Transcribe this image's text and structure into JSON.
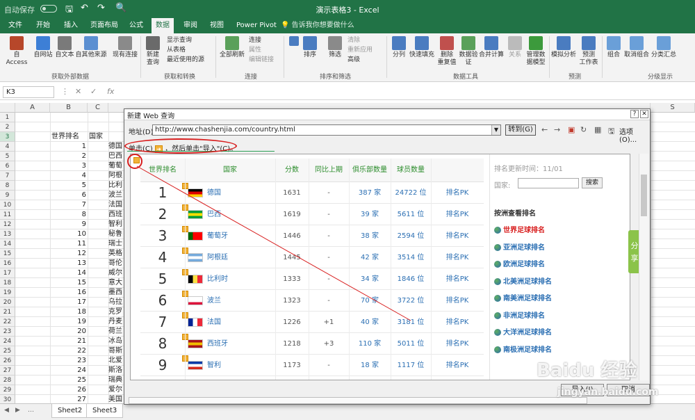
{
  "titlebar": {
    "autosave": "自动保存",
    "title": "演示表格3 - Excel"
  },
  "tabs": [
    "文件",
    "开始",
    "插入",
    "页面布局",
    "公式",
    "数据",
    "审阅",
    "视图",
    "Power Pivot"
  ],
  "tell_me": "告诉我你想要做什么",
  "ribbon": {
    "from_access": "自 Access",
    "from_web": "自网站",
    "from_text": "自文本",
    "from_other": "自其他来源",
    "existing_conn": "现有连接",
    "g_external": "获取外部数据",
    "new_query": "新建\n查询",
    "show_query": "显示查询",
    "from_table": "从表格",
    "recent_sources": "最近使用的源",
    "g_transform": "获取和转换",
    "refresh_all": "全部刷新",
    "connections": "连接",
    "properties": "属性",
    "edit_links": "编辑链接",
    "g_connections": "连接",
    "sort": "排序",
    "filter": "筛选",
    "clear": "清除",
    "reapply": "重新应用",
    "advanced": "高级",
    "g_sortfilter": "排序和筛选",
    "text_to_cols": "分列",
    "flash_fill": "快速填充",
    "remove_dup": "删除\n重复值",
    "data_valid": "数据验\n证",
    "consolidate": "合并计算",
    "relationships": "关系",
    "manage_model": "管理数\n据模型",
    "g_datatools": "数据工具",
    "whatif": "模拟分析",
    "forecast": "预测\n工作表",
    "g_forecast": "预测",
    "group": "组合",
    "ungroup": "取消组合",
    "subtotal": "分类汇总",
    "g_outline": "分级显示"
  },
  "namebox": "K3",
  "columns": [
    "A",
    "B",
    "C",
    "S"
  ],
  "rows": [
    "1",
    "2",
    "3",
    "4",
    "5",
    "6",
    "7",
    "8",
    "9",
    "10",
    "11",
    "12",
    "13",
    "14",
    "15",
    "16",
    "17",
    "18",
    "19",
    "20",
    "21",
    "22",
    "23",
    "24",
    "25",
    "26",
    "27",
    "28",
    "29",
    "30"
  ],
  "sheet_headers": {
    "world_rank": "世界排名",
    "country": "国家"
  },
  "sheet_rows": [
    {
      "rank": "1",
      "country": "德国"
    },
    {
      "rank": "2",
      "country": "巴西"
    },
    {
      "rank": "3",
      "country": "葡萄"
    },
    {
      "rank": "4",
      "country": "阿根"
    },
    {
      "rank": "5",
      "country": "比利"
    },
    {
      "rank": "6",
      "country": "波兰"
    },
    {
      "rank": "7",
      "country": "法国"
    },
    {
      "rank": "8",
      "country": "西班"
    },
    {
      "rank": "9",
      "country": "智利"
    },
    {
      "rank": "10",
      "country": "秘鲁"
    },
    {
      "rank": "11",
      "country": "瑞士"
    },
    {
      "rank": "12",
      "country": "英格"
    },
    {
      "rank": "13",
      "country": "哥伦"
    },
    {
      "rank": "14",
      "country": "威尔"
    },
    {
      "rank": "15",
      "country": "意大"
    },
    {
      "rank": "16",
      "country": "墨西"
    },
    {
      "rank": "17",
      "country": "乌拉"
    },
    {
      "rank": "18",
      "country": "克罗"
    },
    {
      "rank": "19",
      "country": "丹麦"
    },
    {
      "rank": "20",
      "country": "荷兰"
    },
    {
      "rank": "21",
      "country": "冰岛"
    },
    {
      "rank": "22",
      "country": "哥斯"
    },
    {
      "rank": "23",
      "country": "北爱"
    },
    {
      "rank": "24",
      "country": "斯洛"
    },
    {
      "rank": "25",
      "country": "瑞典"
    },
    {
      "rank": "26",
      "country": "爱尔"
    },
    {
      "rank": "27",
      "country": "美国"
    }
  ],
  "sheet_tabs": [
    "Sheet2",
    "Sheet3"
  ],
  "dialog": {
    "title": "新建 Web 查询",
    "address_label": "地址(D):",
    "address": "http://www.chashenjia.com/country.html",
    "go": "转到(G)",
    "options": "选项(O)...",
    "hint_click": "单击(C)",
    "hint_then": "，然后单击\"导入\"(C)。",
    "import": "导入(I)",
    "cancel": "取消"
  },
  "web": {
    "headers": [
      "世界排名",
      "国家",
      "分数",
      "同比上期",
      "俱乐部数量",
      "球员数量",
      ""
    ],
    "rows": [
      {
        "rank": "1",
        "country": "德国",
        "score": "1631",
        "change": "-",
        "clubs": "387 家",
        "players": "24722 位",
        "pk": "排名PK"
      },
      {
        "rank": "2",
        "country": "巴西",
        "score": "1619",
        "change": "-",
        "clubs": "39 家",
        "players": "5611 位",
        "pk": "排名PK"
      },
      {
        "rank": "3",
        "country": "葡萄牙",
        "score": "1446",
        "change": "-",
        "clubs": "38 家",
        "players": "2594 位",
        "pk": "排名PK"
      },
      {
        "rank": "4",
        "country": "阿根廷",
        "score": "1445",
        "change": "-",
        "clubs": "42 家",
        "players": "3514 位",
        "pk": "排名PK"
      },
      {
        "rank": "5",
        "country": "比利时",
        "score": "1333",
        "change": "-",
        "clubs": "34 家",
        "players": "1846 位",
        "pk": "排名PK"
      },
      {
        "rank": "6",
        "country": "波兰",
        "score": "1323",
        "change": "-",
        "clubs": "70 家",
        "players": "3722 位",
        "pk": "排名PK"
      },
      {
        "rank": "7",
        "country": "法国",
        "score": "1226",
        "change": "+1",
        "clubs": "40 家",
        "players": "3181 位",
        "pk": "排名PK"
      },
      {
        "rank": "8",
        "country": "西班牙",
        "score": "1218",
        "change": "+3",
        "clubs": "110 家",
        "players": "5011 位",
        "pk": "排名PK"
      },
      {
        "rank": "9",
        "country": "智利",
        "score": "1173",
        "change": "-",
        "clubs": "18 家",
        "players": "1117 位",
        "pk": "排名PK"
      }
    ],
    "side": {
      "update": "排名更新时间：11/01",
      "country_label": "国家:",
      "search": "搜索",
      "by_continent": "按洲查看排名",
      "links": [
        "世界足球排名",
        "亚洲足球排名",
        "欧洲足球排名",
        "北美洲足球排名",
        "南美洲足球排名",
        "非洲足球排名",
        "大洋洲足球排名",
        "南极洲足球排名"
      ]
    },
    "share": "分享"
  },
  "watermark": {
    "main": "Baidu 经验",
    "sub": "jingyan.baidu.com"
  },
  "colors": {
    "excel_green": "#217346",
    "link_blue": "#2b6fb3",
    "header_green": "#2d8d2d",
    "accent_red": "#d81e1e"
  }
}
